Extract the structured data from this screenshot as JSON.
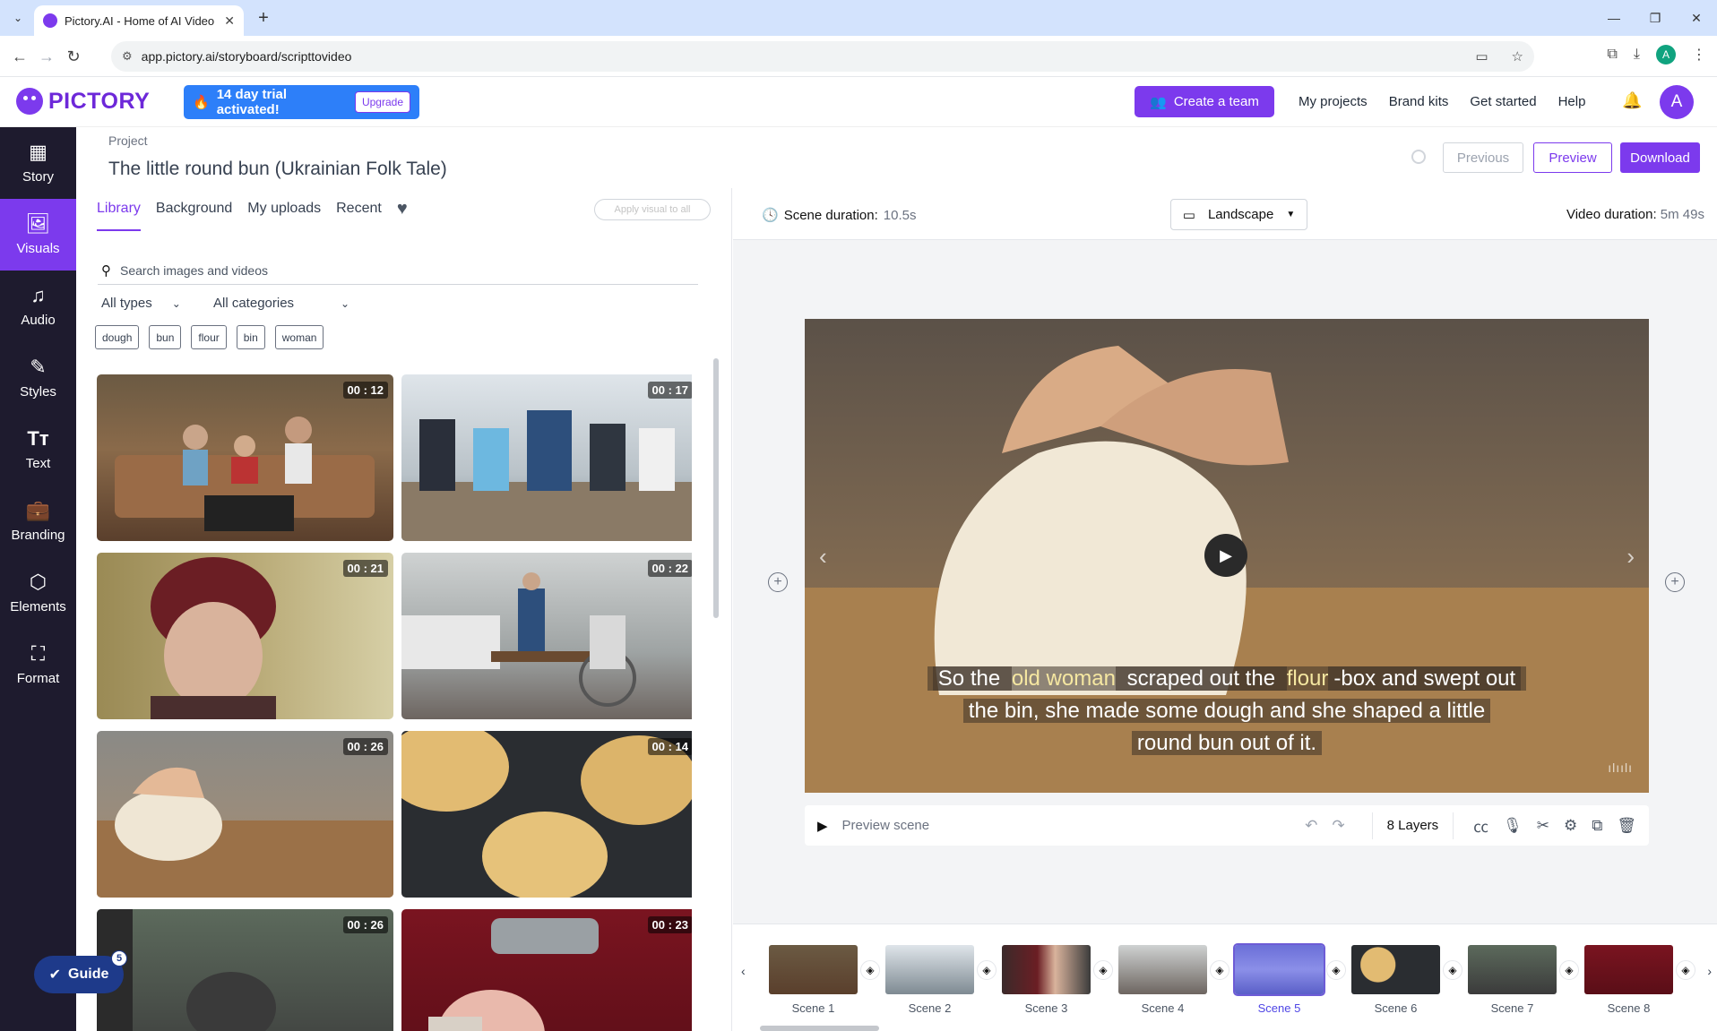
{
  "browser": {
    "tab_title": "Pictory.AI - Home of AI Video E",
    "url": "app.pictory.ai/storyboard/scripttovideo",
    "profile_initial": "A"
  },
  "header": {
    "logo_text": "PICTORY",
    "trial_text": "14 day trial activated!",
    "upgrade_label": "Upgrade",
    "create_team_label": "Create a team",
    "links": [
      "My projects",
      "Brand kits",
      "Get started",
      "Help"
    ],
    "avatar_initial": "A"
  },
  "sidebar": {
    "items": [
      {
        "label": "Story",
        "icon": "grid-icon"
      },
      {
        "label": "Visuals",
        "icon": "image-icon"
      },
      {
        "label": "Audio",
        "icon": "music-icon"
      },
      {
        "label": "Styles",
        "icon": "brush-icon"
      },
      {
        "label": "Text",
        "icon": "text-icon"
      },
      {
        "label": "Branding",
        "icon": "briefcase-icon"
      },
      {
        "label": "Elements",
        "icon": "shapes-icon"
      },
      {
        "label": "Format",
        "icon": "format-icon"
      }
    ],
    "active": "Visuals",
    "guide_label": "Guide",
    "guide_badge": "5"
  },
  "project": {
    "label": "Project",
    "title": "The little round bun (Ukrainian Folk Tale)",
    "previous_label": "Previous",
    "preview_label": "Preview",
    "download_label": "Download"
  },
  "library": {
    "tabs": [
      "Library",
      "Background",
      "My uploads",
      "Recent"
    ],
    "active_tab": "Library",
    "apply_all_label": "Apply visual to all",
    "search_placeholder": "Search images and videos",
    "type_filter": "All types",
    "category_filter": "All categories",
    "chips": [
      "dough",
      "bun",
      "flour",
      "bin",
      "woman"
    ],
    "items": [
      {
        "duration": "00 : 12"
      },
      {
        "duration": "00 : 17"
      },
      {
        "duration": "00 : 21"
      },
      {
        "duration": "00 : 22"
      },
      {
        "duration": "00 : 26"
      },
      {
        "duration": "00 : 14"
      },
      {
        "duration": "00 : 26"
      },
      {
        "duration": "00 : 23"
      }
    ]
  },
  "preview": {
    "scene_duration_label": "Scene duration:",
    "scene_duration_value": "10.5s",
    "orientation": "Landscape",
    "video_duration_label": "Video duration:",
    "video_duration_value": "5m 49s",
    "caption": {
      "l1_a": "So the ",
      "l1_hl1": "old woman",
      "l1_b": " scraped out the ",
      "l1_hl2": "flour",
      "l1_c": "-box and swept out",
      "l2": "the bin, she made some dough and she shaped a little",
      "l3": "round bun out of it."
    },
    "preview_scene_label": "Preview scene",
    "layers_label": "8 Layers"
  },
  "timeline": {
    "scenes": [
      "Scene 1",
      "Scene 2",
      "Scene 3",
      "Scene 4",
      "Scene 5",
      "Scene 6",
      "Scene 7",
      "Scene 8"
    ],
    "active_scene": "Scene 5"
  }
}
